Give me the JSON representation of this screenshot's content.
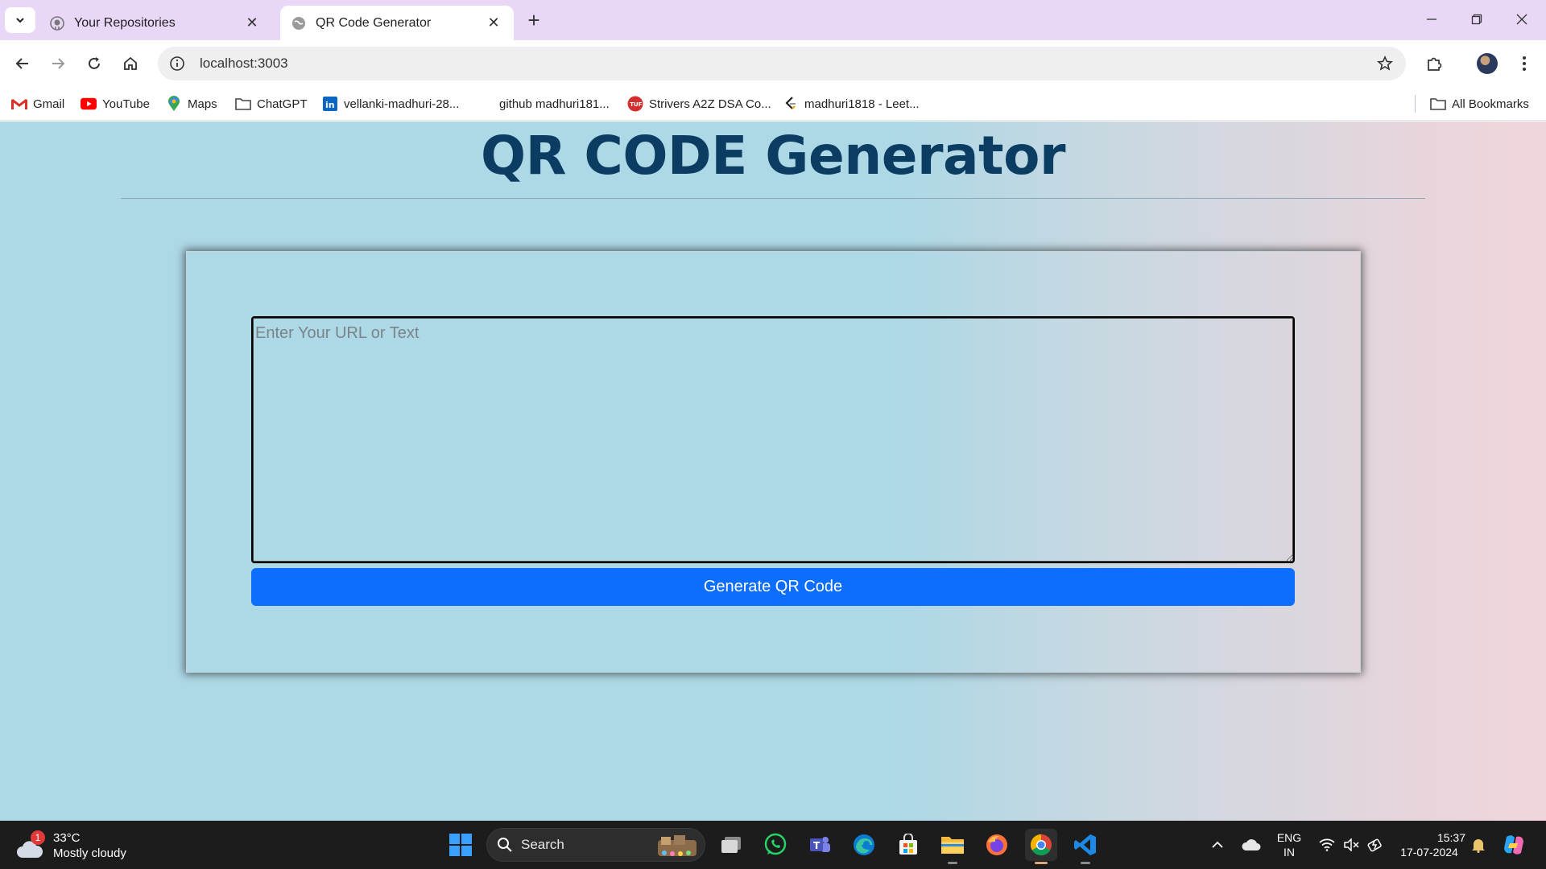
{
  "browser": {
    "tabs": [
      {
        "title": "Your Repositories",
        "icon": "github-icon",
        "active": false
      },
      {
        "title": "QR Code Generator",
        "icon": "globe-icon",
        "active": true
      }
    ],
    "url": "localhost:3003",
    "bookmarks": [
      {
        "label": "Gmail",
        "icon": "gmail-icon"
      },
      {
        "label": "YouTube",
        "icon": "youtube-icon"
      },
      {
        "label": "Maps",
        "icon": "maps-icon"
      },
      {
        "label": "ChatGPT",
        "icon": "folder-icon"
      },
      {
        "label": "vellanki-madhuri-28...",
        "icon": "linkedin-icon"
      },
      {
        "label": "github madhuri181...",
        "icon": ""
      },
      {
        "label": "Strivers A2Z DSA Co...",
        "icon": "tuf-icon"
      },
      {
        "label": "madhuri1818 - Leet...",
        "icon": "leetcode-icon"
      }
    ],
    "all_bookmarks_label": "All Bookmarks"
  },
  "page": {
    "title": "QR CODE Generator",
    "input_placeholder": "Enter Your URL or Text",
    "input_value": "",
    "button_label": "Generate QR Code"
  },
  "taskbar": {
    "weather": {
      "temp": "33°C",
      "condition": "Mostly cloudy",
      "badge": "1"
    },
    "search_label": "Search",
    "lang_top": "ENG",
    "lang_bottom": "IN",
    "time": "15:37",
    "date": "17-07-2024"
  },
  "colors": {
    "tabstrip": "#e9d7f8",
    "page_bg_left": "#add8e6",
    "page_bg_right": "#f0d6dc",
    "title": "#0b3d63",
    "button": "#0d6efd",
    "taskbar": "#1c1c1c"
  }
}
